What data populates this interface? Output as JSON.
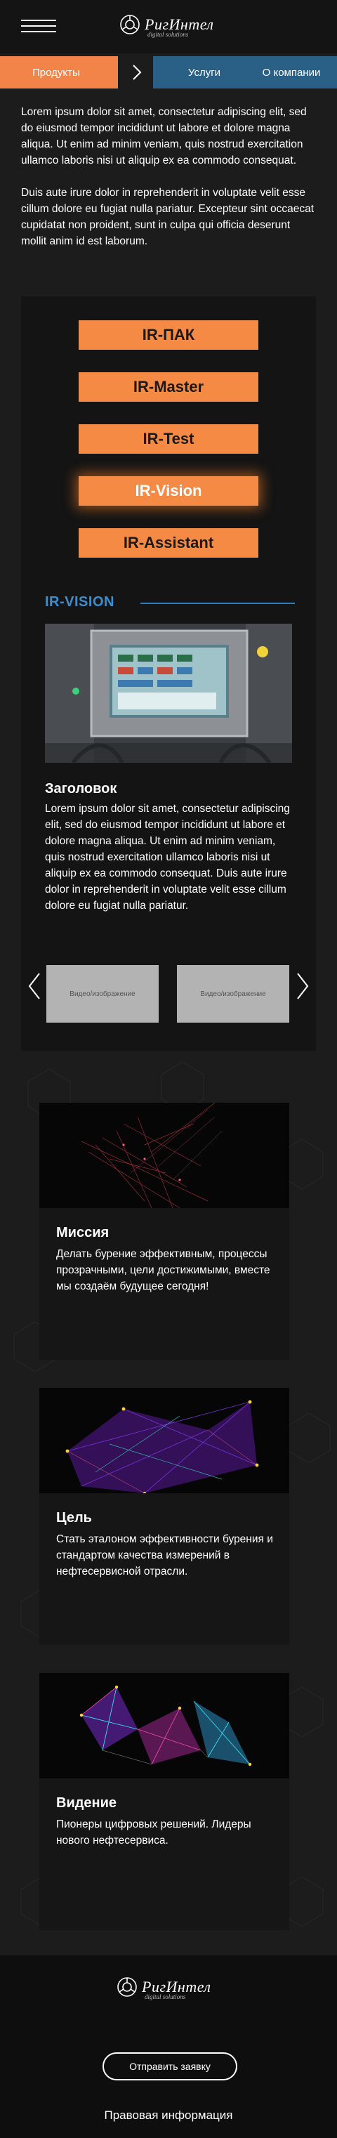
{
  "header": {
    "logo_text": "РигИнтел",
    "logo_sub": "digital solutions"
  },
  "tabs": [
    {
      "label": "Продукты",
      "active": true
    },
    {
      "label": "Услуги",
      "active": false
    },
    {
      "label": "О компании",
      "active": false
    }
  ],
  "intro": {
    "p1": "Lorem ipsum dolor sit amet, consectetur adipiscing elit, sed do eiusmod tempor incididunt ut labore et dolore magna aliqua. Ut enim ad minim veniam, quis nostrud exercitation ullamco laboris nisi ut aliquip ex ea commodo consequat.",
    "p2": "Duis aute irure dolor in reprehenderit in voluptate velit esse cillum dolore eu fugiat nulla pariatur. Excepteur sint occaecat cupidatat non proident, sunt in culpa qui officia deserunt mollit anim id est laborum."
  },
  "products": [
    {
      "label": "IR-ПАК",
      "active": false
    },
    {
      "label": "IR-Master",
      "active": false
    },
    {
      "label": "IR-Test",
      "active": false
    },
    {
      "label": "IR-Vision",
      "active": true
    },
    {
      "label": "IR-Assistant",
      "active": false
    }
  ],
  "product_detail": {
    "section_title": "IR-VISION",
    "title": "Заголовок",
    "text": "Lorem ipsum dolor sit amet, consectetur adipiscing elit, sed do eiusmod tempor incididunt ut labore et dolore magna aliqua. Ut enim ad minim veniam, quis nostrud exercitation ullamco laboris nisi ut aliquip ex ea commodo consequat. Duis aute irure dolor in reprehenderit in voluptate velit esse cillum dolore eu fugiat nulla pariatur.",
    "videos": [
      "Видео/изображение",
      "Видео/изображение"
    ]
  },
  "cards": [
    {
      "title": "Миссия",
      "text": "Делать бурение эффективным, процессы прозрачными, цели достижимыми, вместе мы создаём будущее сегодня!"
    },
    {
      "title": "Цель",
      "text": "Стать эталоном эффективности бурения и стандартом качества измерений в нефтесервисной отрасли."
    },
    {
      "title": "Видение",
      "text": "Пионеры цифровых решений. Лидеры нового нефтесервиса."
    }
  ],
  "footer": {
    "button_label": "Отправить заявку",
    "legal_link": "Правовая информация"
  },
  "colors": {
    "accent_orange": "#f48a43",
    "tab_blue": "#2a5f86",
    "section_blue": "#3b8fd0",
    "background": "#1c1c1c"
  }
}
